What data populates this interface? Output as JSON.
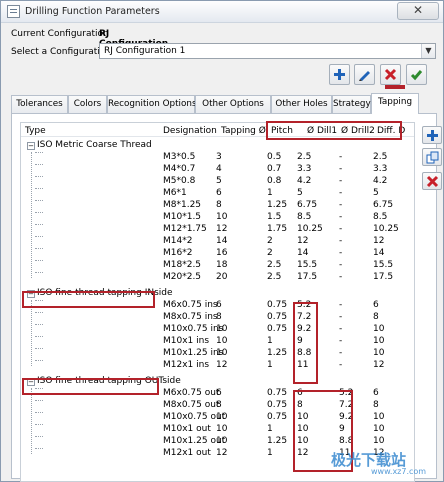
{
  "window": {
    "title": "Drilling Function Parameters",
    "close_label": "✕"
  },
  "config": {
    "current_label": "Current Configuration",
    "current_value": "RJ Configuration 1",
    "select_label": "Select a Configuration",
    "select_value": "RJ Configuration 1"
  },
  "toolbar": {
    "buttons": [
      {
        "name": "add-configuration-button",
        "icon": "plus-icon"
      },
      {
        "name": "edit-configuration-button",
        "icon": "pencil-icon"
      },
      {
        "name": "delete-configuration-button",
        "icon": "delete-x-icon"
      },
      {
        "name": "validate-configuration-button",
        "icon": "checkmark-icon"
      }
    ]
  },
  "tabs": [
    {
      "label": "Tolerances",
      "active": false
    },
    {
      "label": "Colors",
      "active": false
    },
    {
      "label": "Recognition Options",
      "active": false
    },
    {
      "label": "Other Options",
      "active": false
    },
    {
      "label": "Other Holes",
      "active": false
    },
    {
      "label": "Strategy",
      "active": false
    },
    {
      "label": "Tapping",
      "active": true
    }
  ],
  "columns": [
    "Type",
    "Designation",
    "Tapping Ø",
    "Pitch",
    "Ø Dill1",
    "Ø Drill2",
    "Diff. D"
  ],
  "groups": [
    {
      "label": "ISO Metric Coarse Thread",
      "rows": [
        [
          "M3*0.5",
          "3",
          "0.5",
          "2.5",
          "-",
          "2.5"
        ],
        [
          "M4*0.7",
          "4",
          "0.7",
          "3.3",
          "-",
          "3.3"
        ],
        [
          "M5*0.8",
          "5",
          "0.8",
          "4.2",
          "-",
          "4.2"
        ],
        [
          "M6*1",
          "6",
          "1",
          "5",
          "-",
          "5"
        ],
        [
          "M8*1.25",
          "8",
          "1.25",
          "6.75",
          "-",
          "6.75"
        ],
        [
          "M10*1.5",
          "10",
          "1.5",
          "8.5",
          "-",
          "8.5"
        ],
        [
          "M12*1.75",
          "12",
          "1.75",
          "10.25",
          "-",
          "10.25"
        ],
        [
          "M14*2",
          "14",
          "2",
          "12",
          "-",
          "12"
        ],
        [
          "M16*2",
          "16",
          "2",
          "14",
          "-",
          "14"
        ],
        [
          "M18*2.5",
          "18",
          "2.5",
          "15.5",
          "-",
          "15.5"
        ],
        [
          "M20*2.5",
          "20",
          "2.5",
          "17.5",
          "-",
          "17.5"
        ]
      ]
    },
    {
      "label": "ISO fine thread tapping INside",
      "rows": [
        [
          "M6x0.75 ins",
          "6",
          "0.75",
          "5.2",
          "-",
          "6"
        ],
        [
          "M8x0.75 ins",
          "8",
          "0.75",
          "7.2",
          "-",
          "8"
        ],
        [
          "M10x0.75 ins",
          "10",
          "0.75",
          "9.2",
          "-",
          "10"
        ],
        [
          "M10x1 ins",
          "10",
          "1",
          "9",
          "-",
          "10"
        ],
        [
          "M10x1.25 ins",
          "10",
          "1.25",
          "8.8",
          "-",
          "10"
        ],
        [
          "M12x1 ins",
          "12",
          "1",
          "11",
          "-",
          "12"
        ]
      ]
    },
    {
      "label": "ISO fine thread tapping OUTside",
      "rows": [
        [
          "M6x0.75 out",
          "6",
          "0.75",
          "6",
          "5.2",
          "6"
        ],
        [
          "M8x0.75 out",
          "8",
          "0.75",
          "8",
          "7.2",
          "8"
        ],
        [
          "M10x0.75 out",
          "10",
          "0.75",
          "10",
          "9.2",
          "10"
        ],
        [
          "M10x1 out",
          "10",
          "1",
          "10",
          "9",
          "10"
        ],
        [
          "M10x1.25 out",
          "10",
          "1.25",
          "10",
          "8.8",
          "10"
        ],
        [
          "M12x1 out",
          "12",
          "1",
          "12",
          "11",
          "12"
        ]
      ]
    }
  ],
  "side_buttons": [
    {
      "name": "add-row-button",
      "icon": "plus-icon"
    },
    {
      "name": "copy-row-button",
      "icon": "copy-icon"
    },
    {
      "name": "delete-row-button",
      "icon": "delete-x-icon"
    }
  ],
  "colors": {
    "highlight": "#b3222a",
    "accent": "#1f63b8",
    "delete": "#c8202a",
    "ok": "#2e8b2e"
  },
  "watermark": {
    "brand": "极光下载站",
    "url": "www.xz7.com"
  }
}
